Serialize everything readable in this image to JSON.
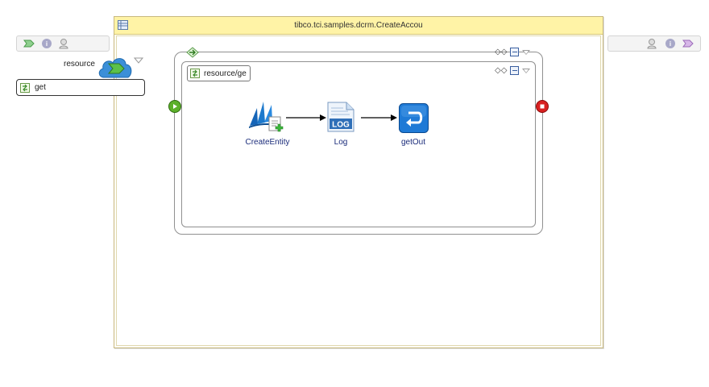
{
  "process": {
    "title": "tibco.tci.samples.dcrm.CreateAccou"
  },
  "service": {
    "resource_label": "resource",
    "operation_label": "get"
  },
  "scope": {
    "tag_label": "resource/ge"
  },
  "activities": [
    {
      "label": "CreateEntity",
      "icon": "dynamics-crm-icon"
    },
    {
      "label": "Log",
      "icon": "log-icon",
      "icon_text": "LOG"
    },
    {
      "label": "getOut",
      "icon": "reply-icon"
    }
  ],
  "icons": {
    "left_palette": [
      "service-arrow-icon",
      "info-icon",
      "users-icon"
    ],
    "right_palette": [
      "users-icon",
      "info-icon",
      "reference-arrow-icon"
    ]
  },
  "colors": {
    "header": "#fff3a6",
    "link_label": "#1a2b7a",
    "start": "#5cb02a",
    "end": "#d82020",
    "reply": "#1f7ad6"
  }
}
